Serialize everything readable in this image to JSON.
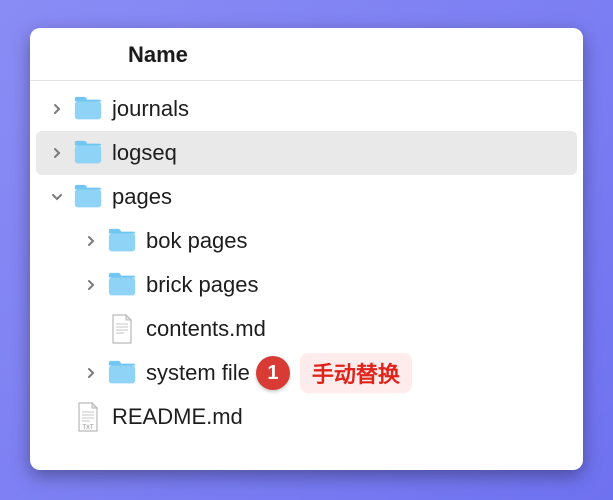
{
  "header": {
    "title": "Name"
  },
  "tree": {
    "items": [
      {
        "name": "journals",
        "type": "folder",
        "depth": 1,
        "arrow": "right",
        "has_arrow": true,
        "selected": false
      },
      {
        "name": "logseq",
        "type": "folder",
        "depth": 1,
        "arrow": "right",
        "has_arrow": true,
        "selected": true
      },
      {
        "name": "pages",
        "type": "folder",
        "depth": 1,
        "arrow": "down",
        "has_arrow": true,
        "selected": false
      },
      {
        "name": "bok pages",
        "type": "folder",
        "depth": 2,
        "arrow": "right",
        "has_arrow": true,
        "selected": false
      },
      {
        "name": "brick pages",
        "type": "folder",
        "depth": 2,
        "arrow": "right",
        "has_arrow": true,
        "selected": false
      },
      {
        "name": "contents.md",
        "type": "file",
        "depth": 2,
        "arrow": "",
        "has_arrow": false,
        "selected": false,
        "ext": "md"
      },
      {
        "name": "system file",
        "type": "folder",
        "depth": 2,
        "arrow": "right",
        "has_arrow": true,
        "selected": false,
        "annotation": {
          "num": "1",
          "text": "手动替换"
        }
      },
      {
        "name": "README.md",
        "type": "file",
        "depth": 1,
        "arrow": "",
        "has_arrow": false,
        "selected": false,
        "ext": "txt"
      }
    ]
  },
  "icons": {
    "folder_color": "#8fd3f7",
    "folder_tab": "#73c6f2"
  }
}
